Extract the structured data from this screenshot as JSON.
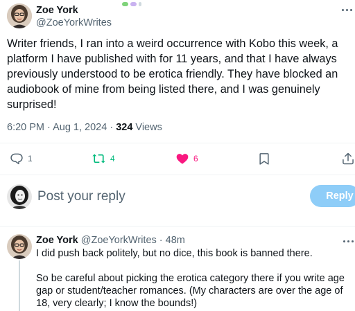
{
  "colors": {
    "text_primary": "#0f1419",
    "text_secondary": "#536471",
    "repost_green": "#00ba7c",
    "like_pink": "#f91880",
    "reply_button_bg": "#8ecdf8",
    "divider": "#eff3f4"
  },
  "tweet": {
    "display_name": "Zoe York",
    "handle": "@ZoeYorkWrites",
    "text": "Writer friends, I ran into a weird occurrence with Kobo this week, a platform I have published with for 11 years, and that I have always previously understood to be erotica friendly. They have blocked an audiobook of mine from being listed there, and I was genuinely surprised!",
    "time_date": "6:20 PM · Aug 1, 2024 · ",
    "views_count": "324",
    "views_label": " Views",
    "actions": {
      "replies": {
        "icon": "reply-icon",
        "count": "1"
      },
      "reposts": {
        "icon": "repost-icon",
        "count": "4"
      },
      "likes": {
        "icon": "heart-icon",
        "count": "6"
      },
      "bookmark": {
        "icon": "bookmark-icon"
      },
      "share": {
        "icon": "share-icon"
      }
    }
  },
  "composer": {
    "placeholder": "Post your reply",
    "button_label": "Reply"
  },
  "reply": {
    "display_name": "Zoe York",
    "meta": " @ZoeYorkWrites · 48m",
    "paragraphs": [
      "I did push back politely, but no dice, this book is banned there.",
      "So be careful about picking the erotica category there if you write age gap or student/teacher romances. (My characters are over the age of 18, very clearly; I know the bounds!)"
    ]
  }
}
